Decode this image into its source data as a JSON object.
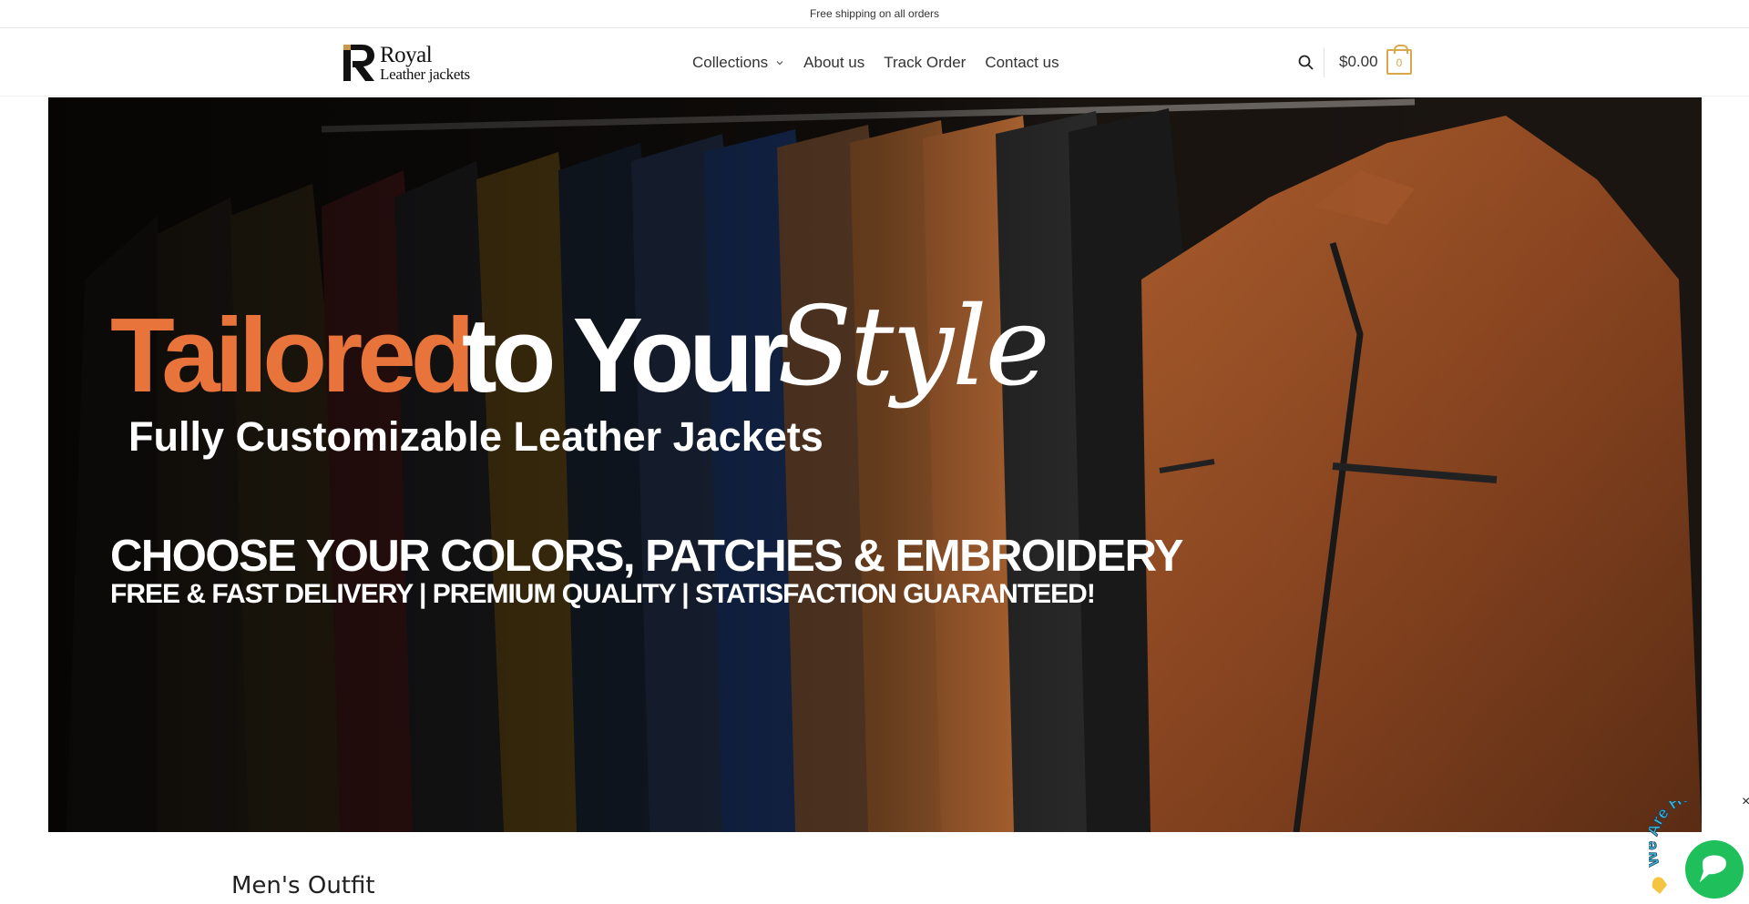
{
  "topbar": {
    "text": "Free shipping on all orders"
  },
  "header": {
    "logo": {
      "line1": "Royal",
      "line2": "Leather jackets"
    },
    "nav": [
      {
        "label": "Collections"
      },
      {
        "label": "About us"
      },
      {
        "label": "Track Order"
      },
      {
        "label": "Contact us"
      }
    ],
    "cart": {
      "total": "$0.00",
      "count": "0"
    }
  },
  "hero": {
    "headline_accent": "Tailored",
    "headline_main": "to Your",
    "headline_script": "Style",
    "subheadline": "Fully Customizable Leather Jackets",
    "tagline": "CHOOSE YOUR COLORS, PATCHES & EMBROIDERY",
    "benefits": "FREE & FAST DELIVERY |  PREMIUM QUALITY | STATISFACTION GUARANTEED!"
  },
  "section": {
    "title": "Men's Outfit"
  },
  "chat": {
    "badge": "We Are Here!",
    "close": "×"
  },
  "colors": {
    "accent_gold": "#d9a84c",
    "hero_orange": "#e8743b",
    "chat_green": "#1fbf5b"
  }
}
